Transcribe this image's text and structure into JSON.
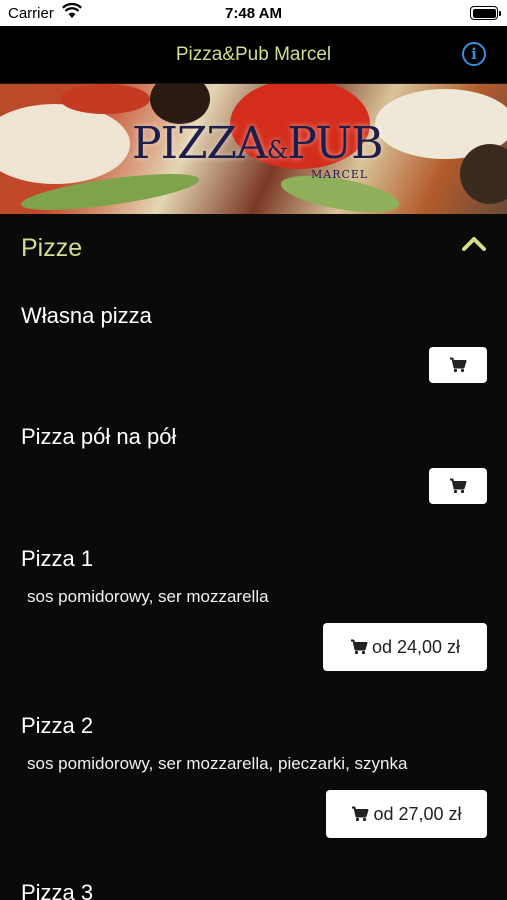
{
  "status_bar": {
    "carrier": "Carrier",
    "time": "7:48 AM"
  },
  "nav": {
    "title": "Pizza&Pub Marcel",
    "info_icon": "info-icon"
  },
  "banner": {
    "logo_main": "PIZZA",
    "logo_amp": "&",
    "logo_pub": "PUB",
    "logo_sub": "MARCEL"
  },
  "section": {
    "title": "Pizze",
    "expanded": true
  },
  "items": [
    {
      "name": "Własna pizza",
      "description": "",
      "price_label": ""
    },
    {
      "name": "Pizza pół na pół",
      "description": "",
      "price_label": ""
    },
    {
      "name": "Pizza 1",
      "description": "sos pomidorowy, ser mozzarella",
      "price_label": "od 24,00 zł"
    },
    {
      "name": "Pizza 2",
      "description": "sos pomidorowy, ser mozzarella, pieczarki, szynka",
      "price_label": "od 27,00 zł"
    },
    {
      "name": "Pizza 3",
      "description": "",
      "price_label": ""
    }
  ],
  "colors": {
    "accent": "#d4dc8e",
    "info": "#3a8fe0",
    "background": "#0a0a0a"
  }
}
